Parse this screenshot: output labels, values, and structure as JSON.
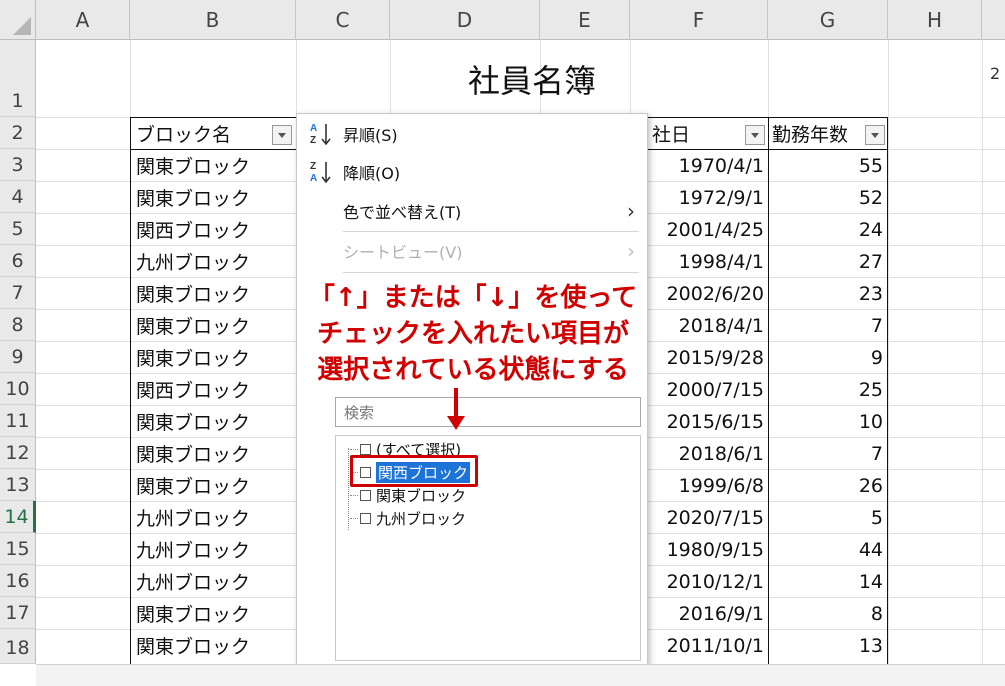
{
  "sheet_title": "社員名簿",
  "columns": [
    "A",
    "B",
    "C",
    "D",
    "E",
    "F",
    "G",
    "H"
  ],
  "rows": [
    "1",
    "2",
    "3",
    "4",
    "5",
    "6",
    "7",
    "8",
    "9",
    "10",
    "11",
    "12",
    "13",
    "14",
    "15",
    "16",
    "17",
    "18"
  ],
  "active_row": "14",
  "headers": {
    "block": "ブロック名",
    "joined": "社日",
    "years": "勤務年数"
  },
  "table_rows": [
    {
      "block": "関東ブロック",
      "date": "1970/4/1",
      "years": "55"
    },
    {
      "block": "関東ブロック",
      "date": "1972/9/1",
      "years": "52"
    },
    {
      "block": "関西ブロック",
      "date": "2001/4/25",
      "years": "24"
    },
    {
      "block": "九州ブロック",
      "date": "1998/4/1",
      "years": "27"
    },
    {
      "block": "関東ブロック",
      "date": "2002/6/20",
      "years": "23"
    },
    {
      "block": "関東ブロック",
      "date": "2018/4/1",
      "years": "7"
    },
    {
      "block": "関東ブロック",
      "date": "2015/9/28",
      "years": "9"
    },
    {
      "block": "関西ブロック",
      "date": "2000/7/15",
      "years": "25"
    },
    {
      "block": "関東ブロック",
      "date": "2015/6/15",
      "years": "10"
    },
    {
      "block": "関東ブロック",
      "date": "2018/6/1",
      "years": "7"
    },
    {
      "block": "関東ブロック",
      "date": "1999/6/8",
      "years": "26"
    },
    {
      "block": "九州ブロック",
      "date": "2020/7/15",
      "years": "5"
    },
    {
      "block": "九州ブロック",
      "date": "1980/9/15",
      "years": "44"
    },
    {
      "block": "九州ブロック",
      "date": "2010/12/1",
      "years": "14"
    },
    {
      "block": "関東ブロック",
      "date": "2016/9/1",
      "years": "8"
    },
    {
      "block": "関東ブロック",
      "date": "2011/10/1",
      "years": "13"
    }
  ],
  "menu": {
    "sort_asc": "昇順(S)",
    "sort_desc": "降順(O)",
    "sort_by_color": "色で並べ替え(T)",
    "sheet_view": "シートビュー(V)",
    "search_placeholder": "検索",
    "list": [
      "(すべて選択)",
      "関西ブロック",
      "関東ブロック",
      "九州ブロック"
    ],
    "selected_item": "関西ブロック"
  },
  "callout": {
    "line1": "「↑」または「↓」を使って",
    "line2": "チェックを入れたい項目が",
    "line3": "選択されている状態にする"
  },
  "edge_text": "2",
  "colors": {
    "accent_red": "#d00000",
    "selection_blue": "#1e73d6",
    "excel_green": "#217346"
  }
}
